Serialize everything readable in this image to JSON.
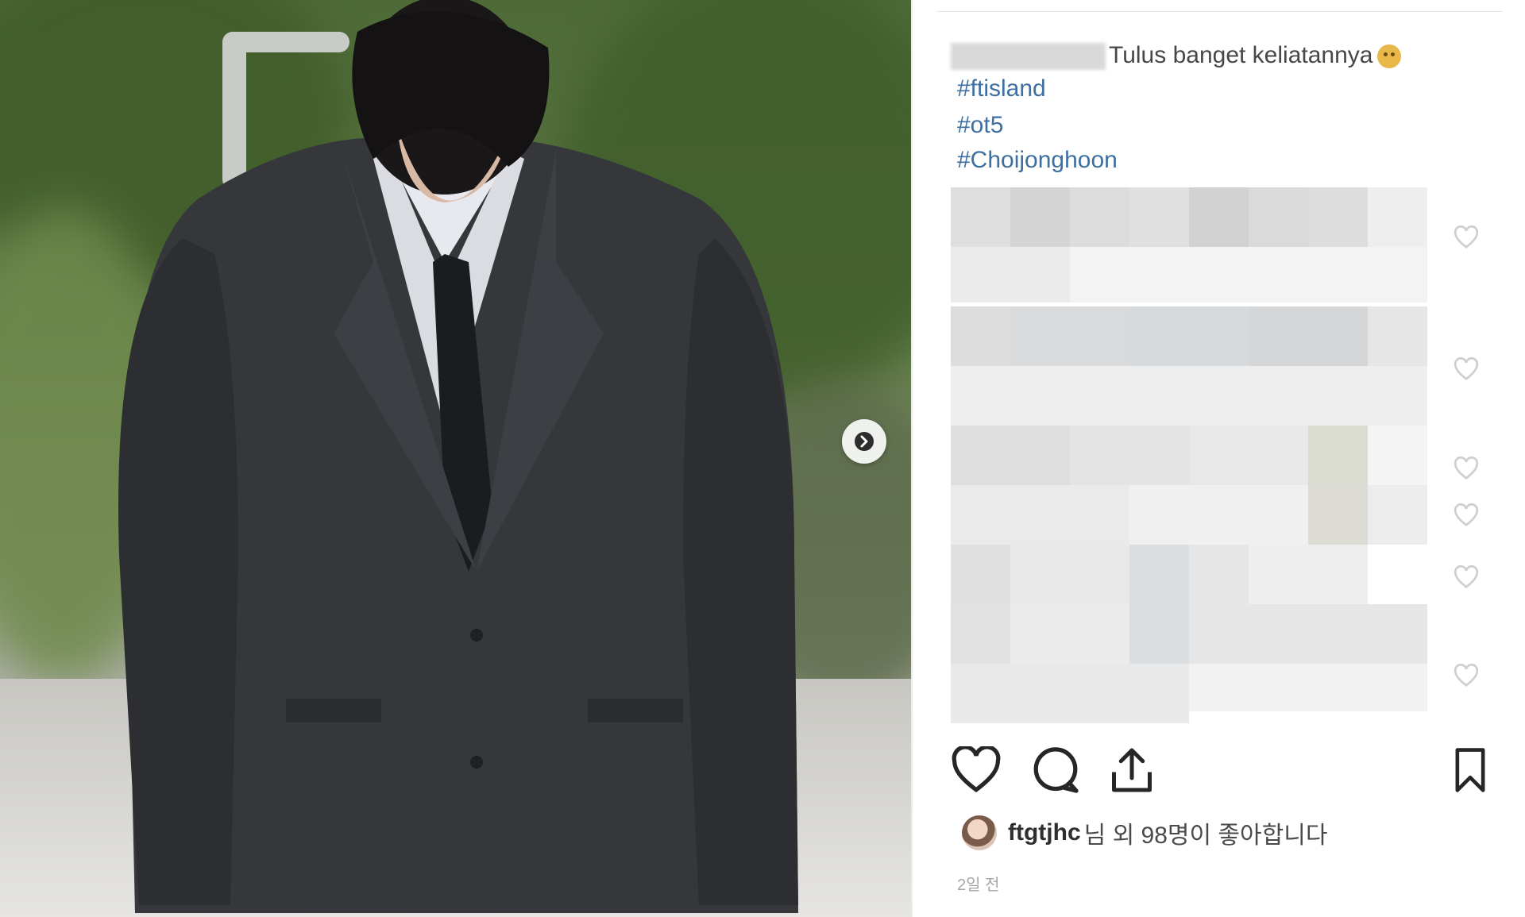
{
  "post": {
    "caption_text": "Tulus banget keliatannya",
    "hashtags": [
      "#ftisland",
      "#ot5",
      "#Choijonghoon"
    ],
    "likes": {
      "username": "ftgtjhc",
      "rest_text": "님 외 98명이 좋아합니다"
    },
    "time_ago": "2일 전",
    "icons": {
      "like": "heart-icon",
      "comment": "comment-bubble-icon",
      "share": "share-upload-icon",
      "save": "bookmark-icon",
      "next": "chevron-right-icon"
    }
  },
  "colors": {
    "hashtag": "#3d6fa0",
    "text": "#333333",
    "muted": "#a6a6a6"
  }
}
